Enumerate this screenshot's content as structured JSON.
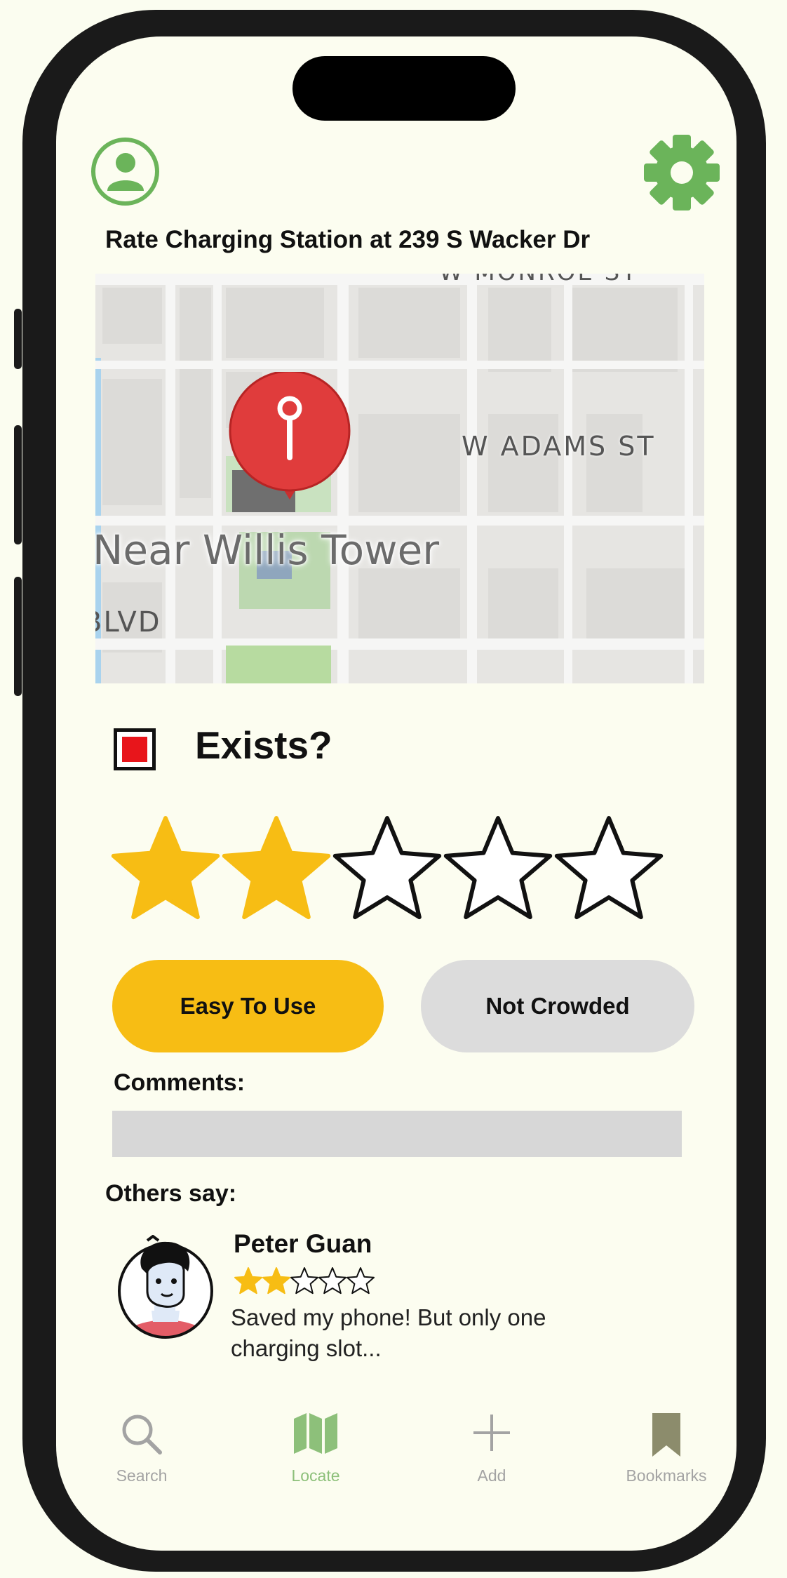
{
  "page": {
    "title": "Rate Charging Station at 239 S Wacker Dr"
  },
  "map": {
    "labels": {
      "street1": "W MONROE ST",
      "street2": "W ADAMS ST",
      "place": "Near Willis Tower",
      "blvd": "BLVD"
    }
  },
  "exists": {
    "label": "Exists?",
    "checked": true
  },
  "rating": {
    "value": 2,
    "max": 5
  },
  "tags": {
    "easy": "Easy To Use",
    "crowd": "Not Crowded"
  },
  "comments": {
    "label": "Comments:",
    "value": ""
  },
  "others": {
    "label": "Others say:",
    "review": {
      "name": "Peter Guan",
      "rating": 2,
      "max": 5,
      "text": "Saved my phone! But only one charging slot..."
    }
  },
  "tabs": [
    {
      "label": "Search",
      "icon": "magnifier-icon"
    },
    {
      "label": "Locate",
      "icon": "map-icon"
    },
    {
      "label": "Add",
      "icon": "plus-icon"
    },
    {
      "label": "Bookmarks",
      "icon": "bookmark-icon"
    }
  ],
  "colors": {
    "accent": "#6bb45a",
    "star": "#f7bd14",
    "pin": "#e03c3c",
    "check": "#e8151b"
  }
}
